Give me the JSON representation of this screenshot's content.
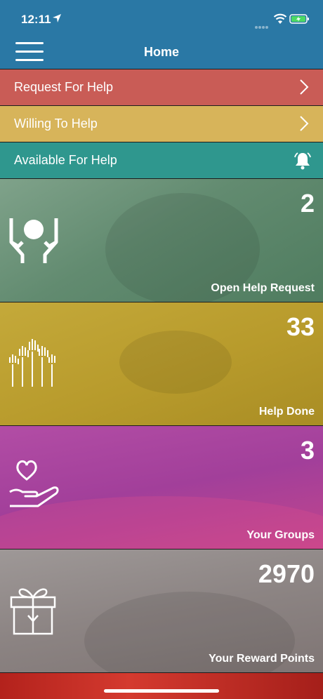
{
  "status_bar": {
    "time": "12:11"
  },
  "header": {
    "title": "Home"
  },
  "menu": [
    {
      "label": "Request For Help",
      "icon": "chevron-right-icon"
    },
    {
      "label": "Willing To Help",
      "icon": "chevron-right-icon"
    },
    {
      "label": "Available For Help",
      "icon": "bell-icon"
    }
  ],
  "tiles": [
    {
      "count": "2",
      "caption": "Open Help Request",
      "icon": "hands-care-icon"
    },
    {
      "count": "33",
      "caption": "Help Done",
      "icon": "raised-hands-icon"
    },
    {
      "count": "3",
      "caption": "Your Groups",
      "icon": "heart-hand-icon"
    },
    {
      "count": "2970",
      "caption": "Your Reward Points",
      "icon": "gift-icon"
    }
  ],
  "colors": {
    "header": "#2a78a5",
    "request": "#c95c56",
    "willing": "#d7b45a",
    "available": "#2f978e",
    "tile_green": "#628b70",
    "tile_yellow": "#b89b2c",
    "tile_magenta": "#a23f9a",
    "tile_gray": "#8c8483"
  }
}
